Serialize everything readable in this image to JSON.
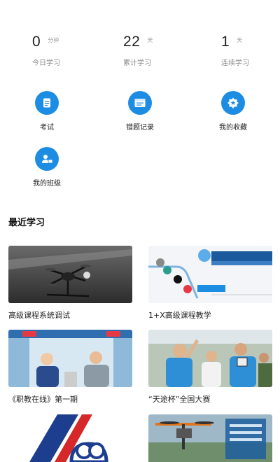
{
  "stats": [
    {
      "value": "0",
      "unit": "分钟",
      "label": "今日学习"
    },
    {
      "value": "22",
      "unit": "天",
      "label": "累计学习"
    },
    {
      "value": "1",
      "unit": "天",
      "label": "连续学习"
    }
  ],
  "actions": [
    {
      "label": "考试",
      "icon": "exam-icon"
    },
    {
      "label": "错题记录",
      "icon": "error-record-icon"
    },
    {
      "label": "我的收藏",
      "icon": "favorites-icon"
    },
    {
      "label": "我的班级",
      "icon": "class-icon"
    }
  ],
  "recent": {
    "title": "最近学习",
    "courses": [
      {
        "title": "高级课程系统调试"
      },
      {
        "title": "1+X高级课程教学"
      },
      {
        "title": "《职教在线》第一期"
      },
      {
        "title": "“天途杯”全国大赛"
      }
    ]
  },
  "colors": {
    "accent": "#1d8de4"
  }
}
